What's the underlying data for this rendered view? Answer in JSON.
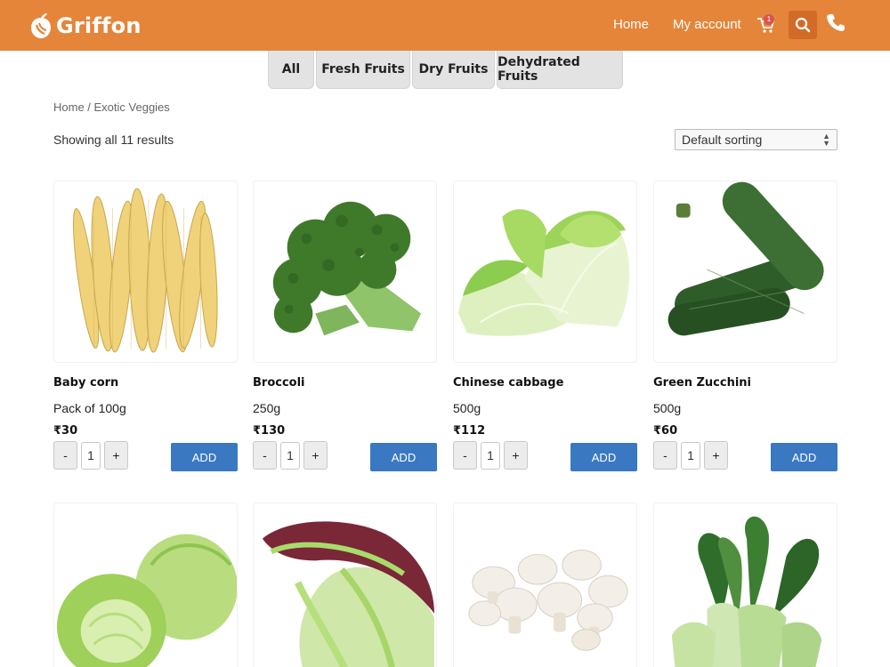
{
  "brand": {
    "name": "Griffon",
    "color": "#e5853a"
  },
  "nav": {
    "home": "Home",
    "account": "My account",
    "cart_count": "1",
    "icons": [
      "cart-icon",
      "search-icon",
      "phone-icon"
    ]
  },
  "tabs": [
    "All",
    "Fresh Fruits",
    "Dry Fruits",
    "Dehydrated Fruits"
  ],
  "breadcrumb": "Home / Exotic Veggies",
  "results_text": "Showing all 11 results",
  "sort": {
    "selected": "Default sorting"
  },
  "products": [
    {
      "name": "Baby corn",
      "weight": "Pack of 100g",
      "price": "₹30",
      "qty": "1",
      "add_label": "ADD"
    },
    {
      "name": "Broccoli",
      "weight": "250g",
      "price": "₹130",
      "qty": "1",
      "add_label": "ADD"
    },
    {
      "name": "Chinese cabbage",
      "weight": "500g",
      "price": "₹112",
      "qty": "1",
      "add_label": "ADD"
    },
    {
      "name": "Green Zucchini",
      "weight": "500g",
      "price": "₹60",
      "qty": "1",
      "add_label": "ADD"
    },
    {
      "name": "",
      "weight": "",
      "price": "",
      "qty": "",
      "add_label": ""
    },
    {
      "name": "",
      "weight": "",
      "price": "",
      "qty": "",
      "add_label": ""
    },
    {
      "name": "",
      "weight": "",
      "price": "",
      "qty": "",
      "add_label": ""
    },
    {
      "name": "",
      "weight": "",
      "price": "",
      "qty": "",
      "add_label": ""
    }
  ],
  "qty_minus": "-",
  "qty_plus": "+",
  "colors": {
    "header": "#e5853a",
    "add_button": "#3a78c2",
    "tab_bg": "#e3e3e3"
  }
}
